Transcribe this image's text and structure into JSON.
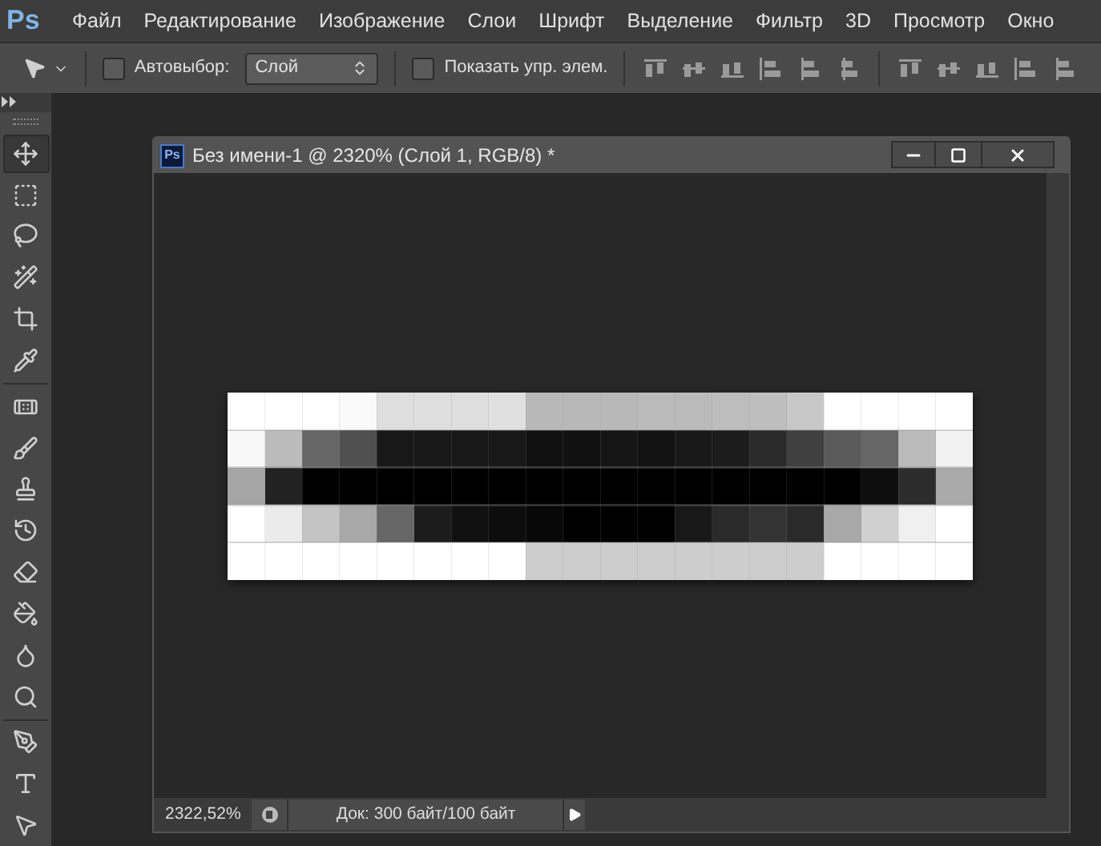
{
  "app": {
    "logo": "Ps"
  },
  "menu": [
    "Файл",
    "Редактирование",
    "Изображение",
    "Слои",
    "Шрифт",
    "Выделение",
    "Фильтр",
    "3D",
    "Просмотр",
    "Окно"
  ],
  "options_bar": {
    "auto_select": {
      "label": "Автовыбор:",
      "checked": false
    },
    "target": {
      "value": "Слой"
    },
    "show_controls": {
      "label": "Показать упр. элем.",
      "checked": false
    }
  },
  "tools": [
    {
      "kind": "move",
      "selected": true
    },
    {
      "kind": "marquee",
      "selected": false
    },
    {
      "kind": "lasso",
      "selected": false
    },
    {
      "kind": "wand",
      "selected": false
    },
    {
      "kind": "crop",
      "selected": false
    },
    {
      "kind": "eyedropper",
      "selected": false
    },
    {
      "kind": "heal",
      "selected": false
    },
    {
      "kind": "brush",
      "selected": false
    },
    {
      "kind": "stamp",
      "selected": false
    },
    {
      "kind": "history",
      "selected": false
    },
    {
      "kind": "eraser",
      "selected": false
    },
    {
      "kind": "bucket",
      "selected": false
    },
    {
      "kind": "blur",
      "selected": false
    },
    {
      "kind": "dodge",
      "selected": false
    },
    {
      "kind": "pen",
      "selected": false
    },
    {
      "kind": "type",
      "selected": false
    },
    {
      "kind": "select",
      "selected": false
    }
  ],
  "document": {
    "icon": "Ps",
    "title": "Без имени-1 @ 2320% (Слой 1, RGB/8) *",
    "zoom": "2322,52%",
    "info": "Док: 300 байт/100 байт"
  }
}
